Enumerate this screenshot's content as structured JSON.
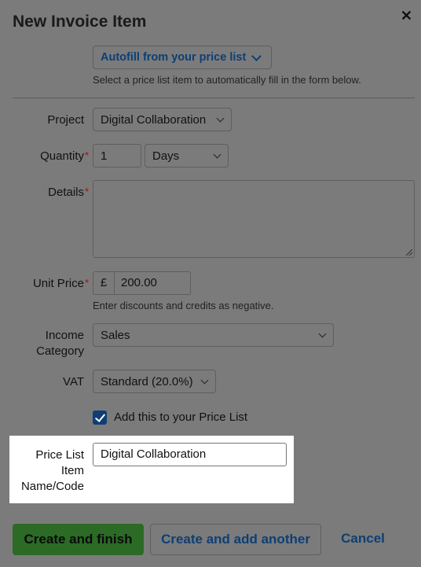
{
  "dialog": {
    "title": "New Invoice Item"
  },
  "autofill": {
    "label": "Autofill from your price list",
    "hint": "Select a price list item to automatically fill in the form below."
  },
  "fields": {
    "project": {
      "label": "Project",
      "value": "Digital Collaboration"
    },
    "quantity": {
      "label": "Quantity",
      "value": "1",
      "unit": "Days"
    },
    "details": {
      "label": "Details",
      "value": ""
    },
    "unit_price": {
      "label": "Unit Price",
      "currency": "£",
      "value": "200.00",
      "hint": "Enter discounts and credits as negative."
    },
    "income_category": {
      "label_line1": "Income",
      "label_line2": "Category",
      "value": "Sales"
    },
    "vat": {
      "label": "VAT",
      "value": "Standard (20.0%)"
    },
    "add_to_price_list": {
      "label": "Add this to your Price List",
      "checked": true
    },
    "price_list_name": {
      "label_line1": "Price List",
      "label_line2": "Item",
      "label_line3": "Name/Code",
      "value": "Digital Collaboration"
    }
  },
  "buttons": {
    "create_finish": "Create and finish",
    "create_another": "Create and add another",
    "cancel": "Cancel"
  },
  "required_marker": "*",
  "colors": {
    "primary": "#2b6b25",
    "link": "#0d3f74",
    "required": "#a0130f",
    "overlay": "#7b7b7b"
  }
}
